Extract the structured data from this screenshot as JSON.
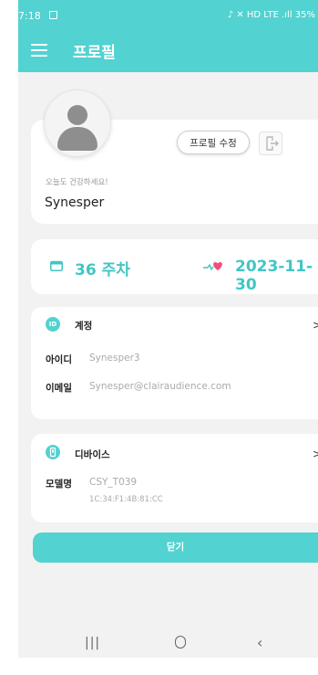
{
  "status_bar": {
    "time": "7:18",
    "right": " ♪ ✕ HD LTE .ıll 35%"
  },
  "app_bar": {
    "title": "프로필"
  },
  "profile": {
    "edit_button": "프로필 수정",
    "greeting": "오늘도 건강하세요!",
    "nickname": "Synesper"
  },
  "pregnancy": {
    "week": "36 주차",
    "due_date": "2023-11-30"
  },
  "account": {
    "icon_text": "ID",
    "title": "계정",
    "chevron": ">",
    "id_label": "아이디",
    "id_value": "Synesper3",
    "email_label": "이메일",
    "email_value": "Synesper@clairaudience.com"
  },
  "device": {
    "title": "디바이스",
    "chevron": ">",
    "model_label": "모델명",
    "model_value": "CSY_T039",
    "mac_value": "1C:34:F1:4B:81:CC"
  },
  "close_button": "닫기",
  "colors": {
    "accent": "#52d2d0",
    "accent_text": "#40c6c4",
    "background": "#f2f2f2"
  }
}
